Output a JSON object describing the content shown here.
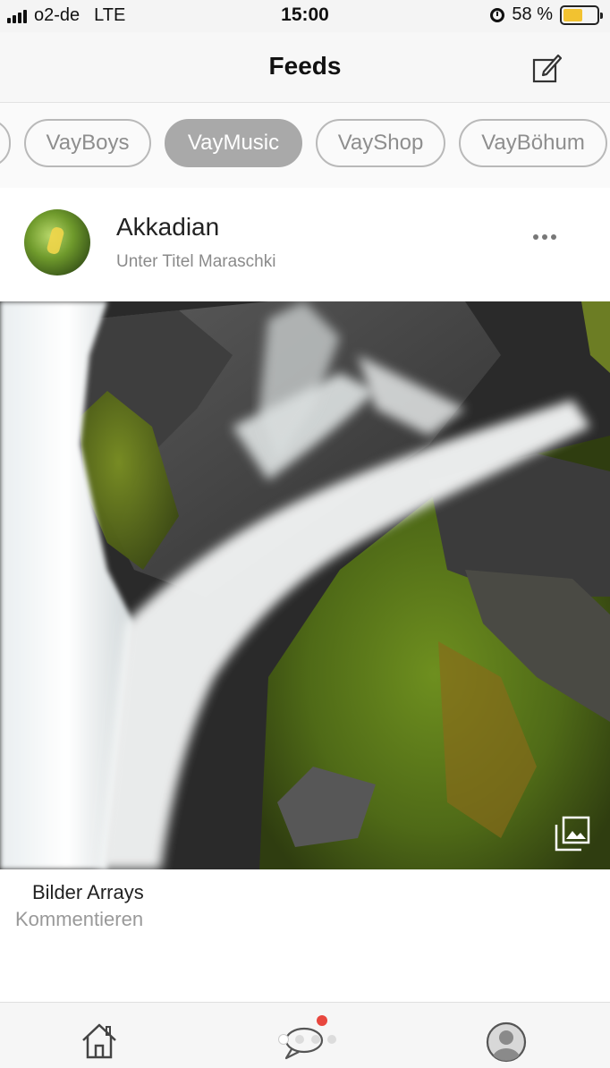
{
  "status_bar": {
    "carrier": "o2-de",
    "network": "LTE",
    "time": "15:00",
    "battery_percent": "58 %",
    "battery_level": 0.58,
    "icons": [
      "signal-icon",
      "alarm-icon",
      "battery-icon"
    ]
  },
  "nav": {
    "title": "Feeds",
    "compose_icon": "compose-icon"
  },
  "tabs": [
    {
      "label": ""
    },
    {
      "label": "VayBoys"
    },
    {
      "label": "VayMusic",
      "active": true
    },
    {
      "label": "VayShop"
    },
    {
      "label": "VayBöhum"
    }
  ],
  "post": {
    "author": "Akkadian",
    "subtitle": "Unter Titel Maraschki",
    "more_icon": "more-icon",
    "gallery_icon": "gallery-icon",
    "caption": "Bilder Arrays",
    "comment_link": "Kommentieren"
  },
  "tab_bar": {
    "items": [
      "home-icon",
      "chat-icon",
      "profile-icon"
    ],
    "page_count": 4,
    "active_page": 1
  },
  "colors": {
    "active_tab": "#a9a9a9",
    "notification_dot": "#e8473e",
    "battery_fill": "#f2c230"
  }
}
